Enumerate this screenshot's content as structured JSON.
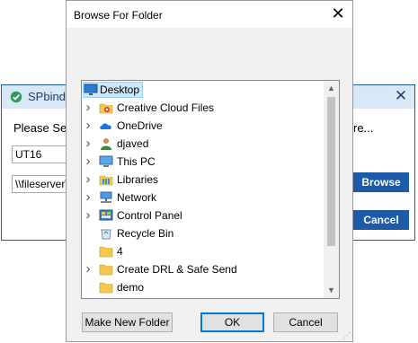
{
  "background_dialog": {
    "title": "SPbinder",
    "prompt": "Please Sele",
    "prompt_tail": "re...",
    "field1_value": "UT16",
    "field2_value": "\\\\fileserver\\",
    "browse_label": "Browse",
    "cancel_label": "Cancel",
    "close_glyph": "✕"
  },
  "browse_dialog": {
    "title": "Browse For Folder",
    "close_glyph": "✕",
    "tree": [
      {
        "label": "Desktop",
        "icon": "desktop-icon",
        "expander": false,
        "selected": true
      },
      {
        "label": "Creative Cloud Files",
        "icon": "creative-cloud-folder-icon",
        "expander": true
      },
      {
        "label": "OneDrive",
        "icon": "onedrive-cloud-icon",
        "expander": true
      },
      {
        "label": "djaved",
        "icon": "user-folder-icon",
        "expander": true
      },
      {
        "label": "This PC",
        "icon": "computer-icon",
        "expander": true
      },
      {
        "label": "Libraries",
        "icon": "libraries-icon",
        "expander": true
      },
      {
        "label": "Network",
        "icon": "network-icon",
        "expander": true
      },
      {
        "label": "Control Panel",
        "icon": "control-panel-icon",
        "expander": true
      },
      {
        "label": "Recycle Bin",
        "icon": "recycle-bin-icon",
        "expander": false
      },
      {
        "label": "4",
        "icon": "folder-icon",
        "expander": false
      },
      {
        "label": "Create DRL & Safe Send",
        "icon": "folder-icon",
        "expander": true
      },
      {
        "label": "demo",
        "icon": "folder-icon",
        "expander": false
      }
    ],
    "buttons": {
      "new_folder": "Make New Folder",
      "ok": "OK",
      "cancel": "Cancel"
    },
    "colors": {
      "selection_fill": "#cce8ff",
      "selection_border": "#99d1ff",
      "accent": "#1e5aa8",
      "folder": "#f5c84c"
    }
  }
}
